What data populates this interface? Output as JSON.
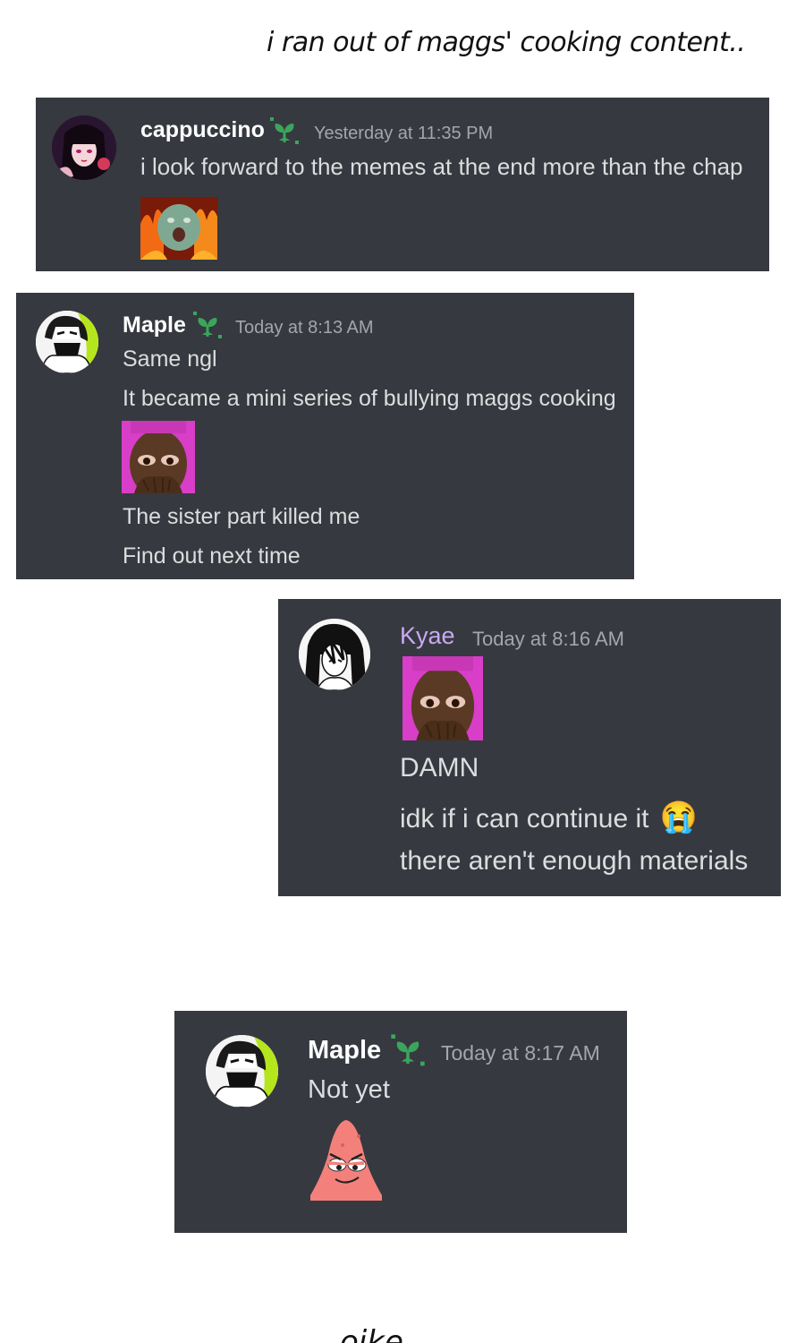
{
  "caption": "i ran out of maggs' cooking content..",
  "footer_text": "oike",
  "colors": {
    "card_bg": "#36393f",
    "name_default": "#ffffff",
    "name_kyae": "#c9a9f3",
    "badge_green": "#3ba55d",
    "timestamp": "#a3a6aa",
    "message": "#dcddde"
  },
  "messages": [
    {
      "username": "cappuccino",
      "timestamp": "Yesterday at 11:35 PM",
      "badge_icon": "sprout-badge-icon",
      "lines": [
        "i look forward to the memes at the end more than the chap"
      ],
      "attachment_icon": "baby-screaming-in-fire-meme"
    },
    {
      "username": "Maple",
      "timestamp": "Today at 8:13 AM",
      "badge_icon": "sprout-badge-icon",
      "lines": [
        "Same ngl",
        "It became a mini series of bullying maggs cooking",
        "The sister part killed me",
        "Find out next time"
      ],
      "attachment_icon": "crying-man-covering-mouth-meme"
    },
    {
      "username": "Kyae",
      "timestamp": "Today at 8:16 AM",
      "lines": [
        "DAMN",
        "idk if i can continue it",
        "there aren't enough materials"
      ],
      "emoji": "😭",
      "attachment_icon": "crying-man-covering-mouth-meme"
    },
    {
      "username": "Maple",
      "timestamp": "Today at 8:17 AM",
      "badge_icon": "sprout-badge-icon",
      "lines": [
        "Not yet"
      ],
      "attachment_icon": "smug-patrick-star-sticker"
    }
  ]
}
